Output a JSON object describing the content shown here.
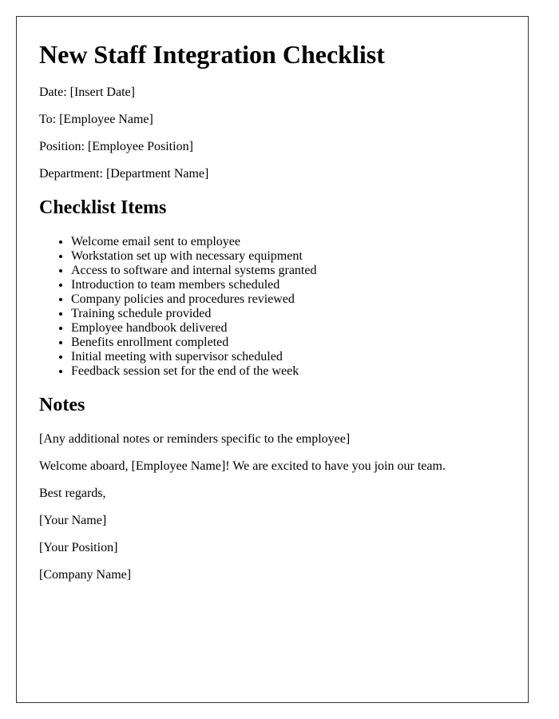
{
  "title": "New Staff Integration Checklist",
  "fields": [
    "Date: [Insert Date]",
    "To: [Employee Name]",
    "Position: [Employee Position]",
    "Department: [Department Name]"
  ],
  "checklist": {
    "heading": "Checklist Items",
    "items": [
      "Welcome email sent to employee",
      "Workstation set up with necessary equipment",
      "Access to software and internal systems granted",
      "Introduction to team members scheduled",
      "Company policies and procedures reviewed",
      "Training schedule provided",
      "Employee handbook delivered",
      "Benefits enrollment completed",
      "Initial meeting with supervisor scheduled",
      "Feedback session set for the end of the week"
    ]
  },
  "notes": {
    "heading": "Notes",
    "placeholder": "[Any additional notes or reminders specific to the employee]",
    "welcome": "Welcome aboard, [Employee Name]! We are excited to have you join our team.",
    "closing": "Best regards,",
    "signature": [
      "[Your Name]",
      "[Your Position]",
      "[Company Name]"
    ]
  }
}
